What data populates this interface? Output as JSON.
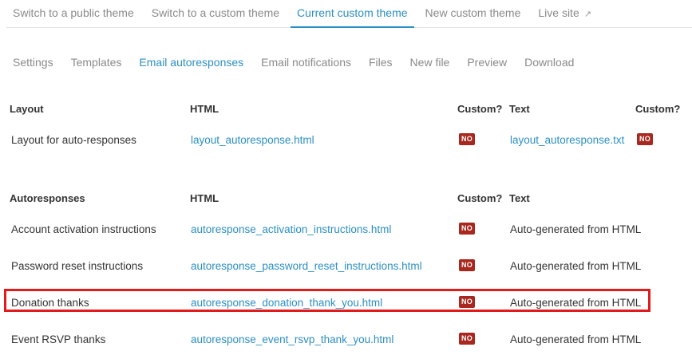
{
  "top_tabs": [
    {
      "label": "Switch to a public theme"
    },
    {
      "label": "Switch to a custom theme"
    },
    {
      "label": "Current custom theme"
    },
    {
      "label": "New custom theme"
    },
    {
      "label": "Live site",
      "icon": "external-link-icon"
    }
  ],
  "top_tabs_active_index": 2,
  "sub_tabs": [
    {
      "label": "Settings"
    },
    {
      "label": "Templates"
    },
    {
      "label": "Email autoresponses"
    },
    {
      "label": "Email notifications"
    },
    {
      "label": "Files"
    },
    {
      "label": "New file"
    },
    {
      "label": "Preview"
    },
    {
      "label": "Download"
    }
  ],
  "sub_tabs_active_index": 2,
  "layout_section": {
    "headers": {
      "name": "Layout",
      "html": "HTML",
      "custom1": "Custom?",
      "text": "Text",
      "custom2": "Custom?"
    },
    "rows": [
      {
        "name": "Layout for auto-responses",
        "html": "layout_autoresponse.html",
        "custom1": "NO",
        "text": "layout_autoresponse.txt",
        "custom2": "NO"
      }
    ]
  },
  "autoresponses_section": {
    "headers": {
      "name": "Autoresponses",
      "html": "HTML",
      "custom1": "Custom?",
      "text": "Text"
    },
    "rows": [
      {
        "name": "Account activation instructions",
        "html": "autoresponse_activation_instructions.html",
        "custom": "NO",
        "text": "Auto-generated from HTML"
      },
      {
        "name": "Password reset instructions",
        "html": "autoresponse_password_reset_instructions.html",
        "custom": "NO",
        "text": "Auto-generated from HTML"
      },
      {
        "name": "Donation thanks",
        "html": "autoresponse_donation_thank_you.html",
        "custom": "NO",
        "text": "Auto-generated from HTML",
        "highlighted": true
      },
      {
        "name": "Event RSVP thanks",
        "html": "autoresponse_event_rsvp_thank_you.html",
        "custom": "NO",
        "text": "Auto-generated from HTML"
      }
    ]
  },
  "colors": {
    "accent": "#2c8fc4",
    "badge": "#a8281f",
    "highlight": "#e11b1b"
  }
}
